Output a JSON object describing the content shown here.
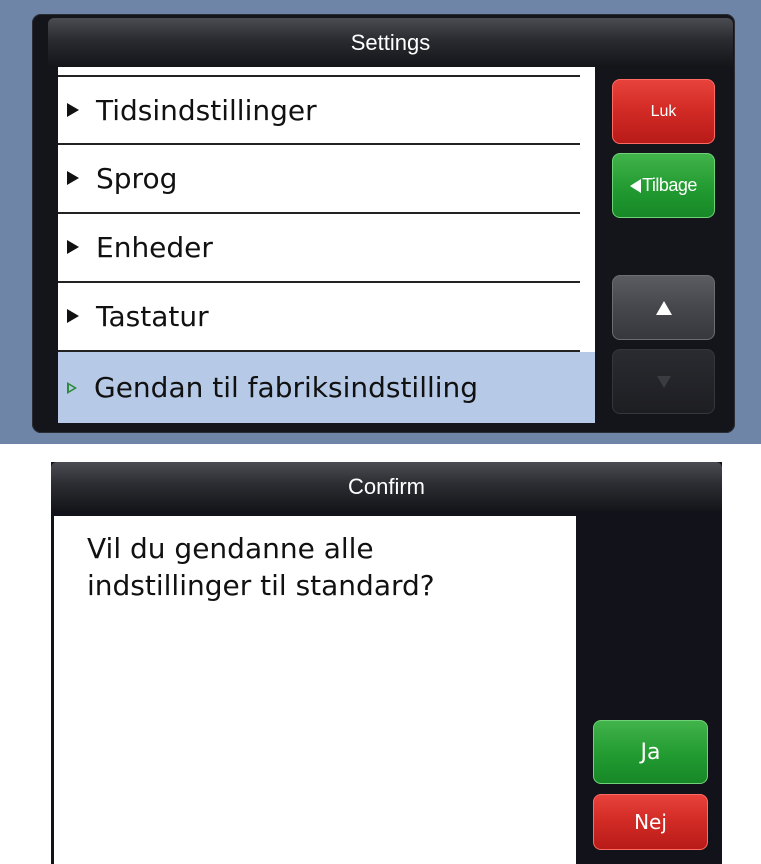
{
  "settings": {
    "title": "Settings",
    "items": [
      {
        "label": "Tidsindstillinger"
      },
      {
        "label": "Sprog"
      },
      {
        "label": "Enheder"
      },
      {
        "label": "Tastatur"
      },
      {
        "label": "Gendan til fabriksindstilling",
        "selected": true
      }
    ],
    "buttons": {
      "close_label": "Luk",
      "back_label": "Tilbage"
    }
  },
  "confirm": {
    "title": "Confirm",
    "message_line1": "Vil du gendanne alle",
    "message_line2": "indstillinger til standard?",
    "yes_label": "Ja",
    "no_label": "Nej"
  },
  "colors": {
    "background": "#6f85a8",
    "selected_row": "#b6c9e6",
    "red_button": "#d12a25",
    "green_button": "#229b31"
  }
}
